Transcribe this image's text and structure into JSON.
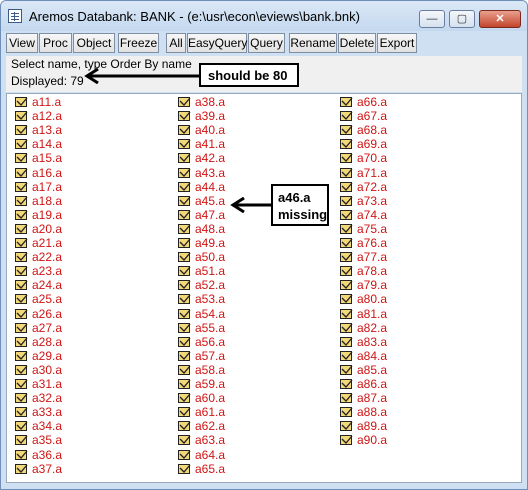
{
  "window": {
    "title": "Aremos Databank: BANK - (e:\\usr\\econ\\eviews\\bank.bnk)",
    "minimize_glyph": "—",
    "maximize_glyph": "▢",
    "close_glyph": "✕"
  },
  "toolbar": {
    "buttons": [
      "View",
      "Proc",
      "Object",
      "Freeze",
      "All",
      "EasyQuery",
      "Query",
      "Rename",
      "Delete",
      "Export"
    ]
  },
  "status": {
    "line1": "Select name, type Order By name",
    "line2": "Displayed: 79"
  },
  "annotations": {
    "count_note": "should be 80",
    "missing_note_line1": "a46.a",
    "missing_note_line2": "missing"
  },
  "list": {
    "columns": [
      [
        "a11.a",
        "a12.a",
        "a13.a",
        "a14.a",
        "a15.a",
        "a16.a",
        "a17.a",
        "a18.a",
        "a19.a",
        "a20.a",
        "a21.a",
        "a22.a",
        "a23.a",
        "a24.a",
        "a25.a",
        "a26.a",
        "a27.a",
        "a28.a",
        "a29.a",
        "a30.a",
        "a31.a",
        "a32.a",
        "a33.a",
        "a34.a",
        "a35.a",
        "a36.a",
        "a37.a"
      ],
      [
        "a38.a",
        "a39.a",
        "a40.a",
        "a41.a",
        "a42.a",
        "a43.a",
        "a44.a",
        "a45.a",
        "a47.a",
        "a48.a",
        "a49.a",
        "a50.a",
        "a51.a",
        "a52.a",
        "a53.a",
        "a54.a",
        "a55.a",
        "a56.a",
        "a57.a",
        "a58.a",
        "a59.a",
        "a60.a",
        "a61.a",
        "a62.a",
        "a63.a",
        "a64.a",
        "a65.a"
      ],
      [
        "a66.a",
        "a67.a",
        "a68.a",
        "a69.a",
        "a70.a",
        "a71.a",
        "a72.a",
        "a73.a",
        "a74.a",
        "a75.a",
        "a76.a",
        "a77.a",
        "a78.a",
        "a79.a",
        "a80.a",
        "a81.a",
        "a82.a",
        "a83.a",
        "a84.a",
        "a85.a",
        "a86.a",
        "a87.a",
        "a88.a",
        "a89.a",
        "a90.a"
      ]
    ],
    "item_icon": "series-checkbox-icon",
    "label_color": "#d11414"
  }
}
